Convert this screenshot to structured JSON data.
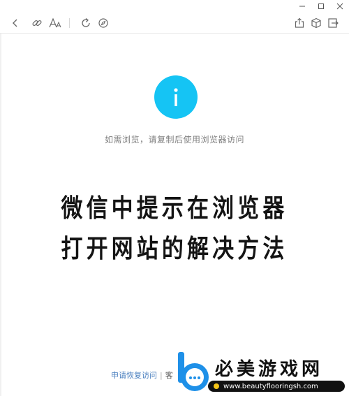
{
  "window_controls": [
    "minimize-icon",
    "maximize-icon",
    "close-icon"
  ],
  "toolbar": {
    "left_icons": [
      "back-arrow-icon",
      "link-icon",
      "font-size-icon",
      "refresh-icon",
      "compass-icon"
    ],
    "right_icons": [
      "share-icon",
      "cube-icon",
      "close-page-icon"
    ]
  },
  "main": {
    "info_glyph": "i",
    "hint_text": "如需浏览，请复制后使用浏览器访问",
    "headline_line1": "微信中提示在浏览器",
    "headline_line2": "打开网站的解决方法",
    "accent_color": "#15c4f4"
  },
  "footer": {
    "appeal_link": "申请恢复访问",
    "separator": "|",
    "truncated_text": "客"
  },
  "watermark": {
    "title": "必美游戏网",
    "url": "www.beautyflooringsh.com"
  }
}
